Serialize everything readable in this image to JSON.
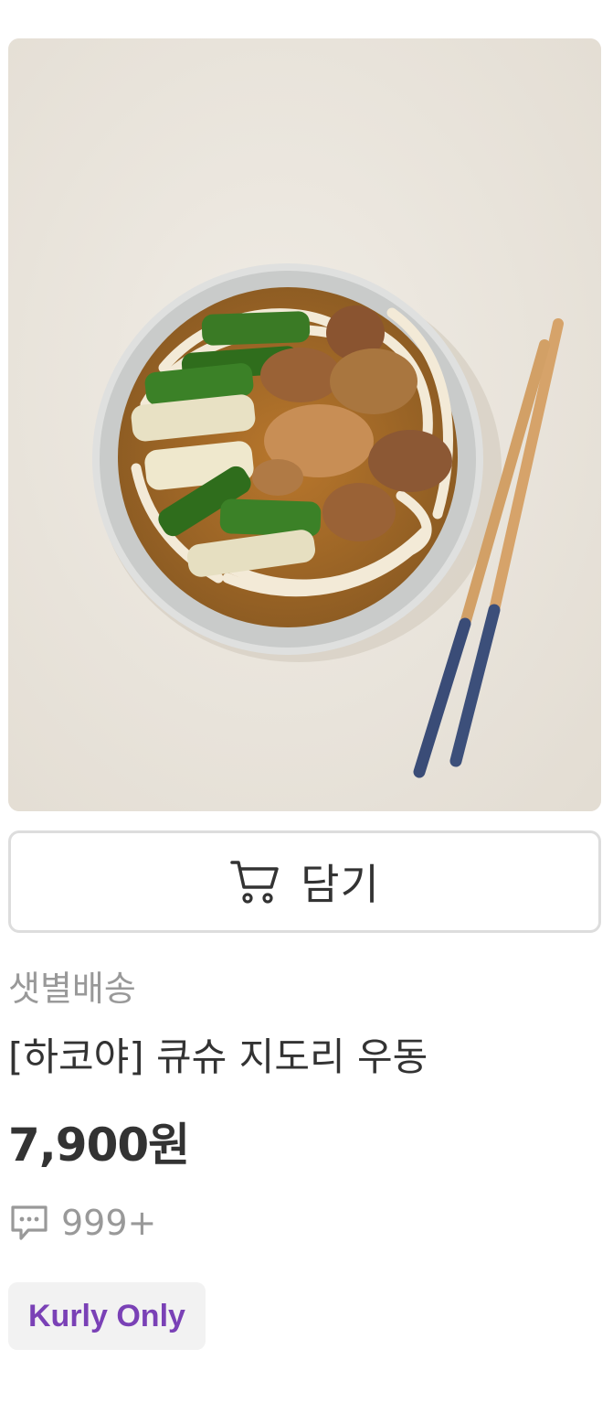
{
  "product": {
    "image_icon": "udon-bowl-photo",
    "cart_button": {
      "icon": "cart-icon",
      "label": "담기"
    },
    "delivery_type": "샛별배송",
    "name": "[하코야] 큐슈 지도리 우동",
    "price": "7,900원",
    "reviews": {
      "icon": "speech-bubble-icon",
      "count": "999+"
    },
    "badge": "Kurly Only"
  },
  "colors": {
    "background": "#ffffff",
    "text_primary": "#333333",
    "text_secondary": "#999999",
    "button_border": "#dddddd",
    "badge_bg": "#f2f2f2",
    "badge_text": "#7a41b6"
  }
}
